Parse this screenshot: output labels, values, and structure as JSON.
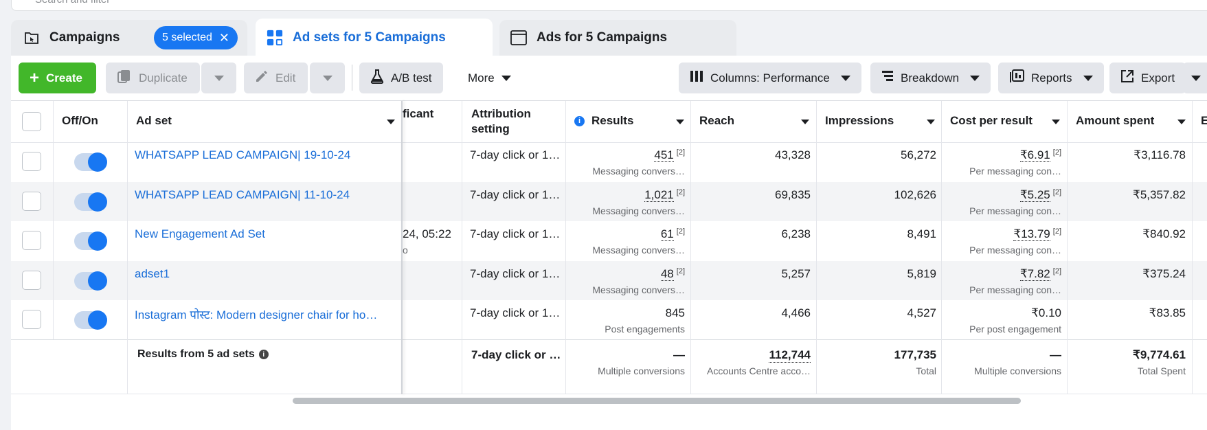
{
  "search": {
    "placeholder": "Search and filter"
  },
  "tabs": {
    "campaigns": {
      "label": "Campaigns",
      "selected_pill": "5 selected"
    },
    "adsets": {
      "label": "Ad sets for 5 Campaigns"
    },
    "ads": {
      "label": "Ads for 5 Campaigns"
    }
  },
  "toolbar": {
    "create": "Create",
    "duplicate": "Duplicate",
    "edit": "Edit",
    "ab_test": "A/B test",
    "more": "More",
    "columns": "Columns: Performance",
    "breakdown": "Breakdown",
    "reports": "Reports",
    "export": "Export"
  },
  "table": {
    "headers": {
      "off_on": "Off/On",
      "ad_set": "Ad set",
      "significant": "ficant",
      "attribution": "Attribution setting",
      "results": "Results",
      "reach": "Reach",
      "impressions": "Impressions",
      "cost_per_result": "Cost per result",
      "amount_spent": "Amount spent",
      "next_col": "E"
    },
    "rows": [
      {
        "name": "WHATSAPP LEAD CAMPAIGN| 19-10-24",
        "sig": "",
        "sig_sub": "",
        "attribution": "7-day click or 1…",
        "results": "451",
        "results_sub": "Messaging convers…",
        "reach": "43,328",
        "impressions": "56,272",
        "cpr": "₹6.91",
        "cpr_sub": "Per messaging con…",
        "spent": "₹3,116.78",
        "on": true,
        "ref": "[2]"
      },
      {
        "name": "WHATSAPP LEAD CAMPAIGN| 11-10-24",
        "sig": "",
        "sig_sub": "",
        "attribution": "7-day click or 1…",
        "results": "1,021",
        "results_sub": "Messaging convers…",
        "reach": "69,835",
        "impressions": "102,626",
        "cpr": "₹5.25",
        "cpr_sub": "Per messaging con…",
        "spent": "₹5,357.82",
        "on": true,
        "ref": "[2]"
      },
      {
        "name": "New Engagement Ad Set",
        "sig": "24, 05:22",
        "sig_sub": "o",
        "attribution": "7-day click or 1…",
        "results": "61",
        "results_sub": "Messaging convers…",
        "reach": "6,238",
        "impressions": "8,491",
        "cpr": "₹13.79",
        "cpr_sub": "Per messaging con…",
        "spent": "₹840.92",
        "on": true,
        "ref": "[2]"
      },
      {
        "name": "adset1",
        "sig": "",
        "sig_sub": "",
        "attribution": "7-day click or 1…",
        "results": "48",
        "results_sub": "Messaging convers…",
        "reach": "5,257",
        "impressions": "5,819",
        "cpr": "₹7.82",
        "cpr_sub": "Per messaging con…",
        "spent": "₹375.24",
        "on": true,
        "ref": "[2]"
      },
      {
        "name": "Instagram पोस्ट: Modern designer chair for ho…",
        "sig": "",
        "sig_sub": "",
        "attribution": "7-day click or 1…",
        "results": "845",
        "results_sub": "Post engagements",
        "reach": "4,466",
        "impressions": "4,527",
        "cpr": "₹0.10",
        "cpr_sub": "Per post engagement",
        "spent": "₹83.85",
        "on": true,
        "ref": ""
      }
    ],
    "summary": {
      "label": "Results from 5 ad sets",
      "attribution": "7-day click or …",
      "results": "—",
      "results_sub": "Multiple conversions",
      "reach": "112,744",
      "reach_sub": "Accounts Centre acco…",
      "impressions": "177,735",
      "impressions_sub": "Total",
      "cpr": "—",
      "cpr_sub": "Multiple conversions",
      "spent": "₹9,774.61",
      "spent_sub": "Total Spent"
    }
  }
}
